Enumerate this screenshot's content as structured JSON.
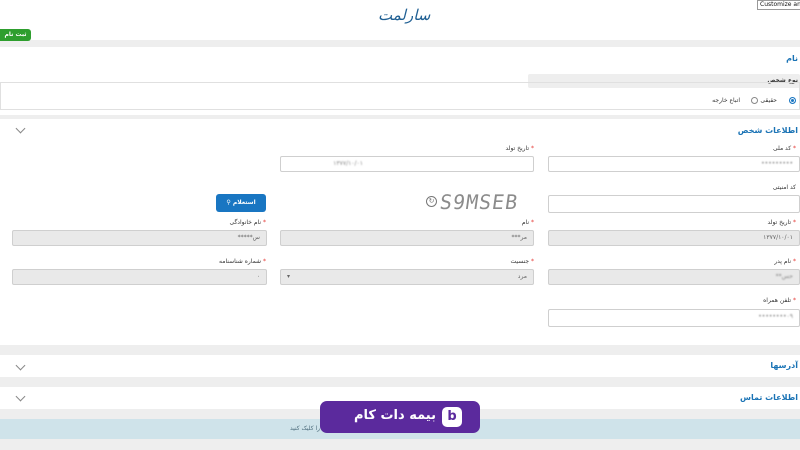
{
  "header": {
    "logo_text": "سارلمت",
    "tooltip": "Customize and"
  },
  "top_button": "ثبت نام",
  "name_section": {
    "title": "نام",
    "person_type_label": "نوع شخص",
    "options": [
      {
        "label": "حقیقی",
        "selected": true
      },
      {
        "label": "اتباع خارجه",
        "selected": false
      }
    ]
  },
  "person_info": {
    "title": "اطلاعات شخص",
    "national_code": {
      "label": "کد ملی",
      "value": "•••••••••"
    },
    "birth_date_top": {
      "label": "تاریخ تولد",
      "value": "۱۳۷۷/۱۰/۰۱"
    },
    "security_code": {
      "label": "کد امنیتی",
      "value": ""
    },
    "captcha_text": "S9MSEB",
    "inquiry_button": "استعلام",
    "birth_date": {
      "label": "تاریخ تولد",
      "value": "۱۳۷۷/۱۰/۰۱"
    },
    "first_name": {
      "label": "نام",
      "value": "مر***"
    },
    "last_name": {
      "label": "نام خانوادگی",
      "value": "س*****"
    },
    "father_name": {
      "label": "نام پدر",
      "value": "حس**"
    },
    "gender": {
      "label": "جنسیت",
      "value": "مرد"
    },
    "id_number": {
      "label": "شماره شناسنامه",
      "value": "۰"
    },
    "mobile": {
      "label": "تلفن همراه",
      "value": "۰۹••••••••"
    }
  },
  "addresses": {
    "title": "آدرسها"
  },
  "contact": {
    "title": "اطلاعات تماس"
  },
  "info_bar_text": "وارد کردن موارد ... را کلیک کنید",
  "watermark": "بیمه دات کام",
  "colors": {
    "accent": "#1976c2",
    "green": "#2e9e2e",
    "brand": "#5b2a9d",
    "required": "#e53935"
  }
}
